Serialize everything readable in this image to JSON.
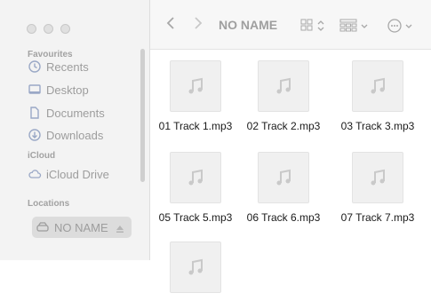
{
  "window": {
    "title": "NO NAME"
  },
  "sidebar": {
    "favourites_title": "Favourites",
    "favourites": [
      {
        "label": "Recents",
        "icon": "clock-icon"
      },
      {
        "label": "Desktop",
        "icon": "desktop-icon"
      },
      {
        "label": "Documents",
        "icon": "document-icon"
      },
      {
        "label": "Downloads",
        "icon": "download-icon"
      }
    ],
    "icloud_title": "iCloud",
    "icloud": [
      {
        "label": "iCloud Drive",
        "icon": "cloud-icon"
      }
    ],
    "locations_title": "Locations",
    "locations": [
      {
        "label": "NO NAME",
        "icon": "drive-icon",
        "eject_icon": "eject-icon",
        "selected": true
      }
    ]
  },
  "toolbar": {
    "back_icon": "chevron-left-icon",
    "forward_icon": "chevron-right-icon",
    "view_icon": "grid-view-icon",
    "group_icon": "group-icon",
    "more_icon": "more-icon"
  },
  "files": [
    {
      "name": "01 Track 1.mp3"
    },
    {
      "name": "02 Track 2.mp3"
    },
    {
      "name": "03 Track 3.mp3"
    },
    {
      "name": "05 Track 5.mp3"
    },
    {
      "name": "06 Track 6.mp3"
    },
    {
      "name": "07 Track 7.mp3"
    },
    {
      "name": ""
    }
  ]
}
